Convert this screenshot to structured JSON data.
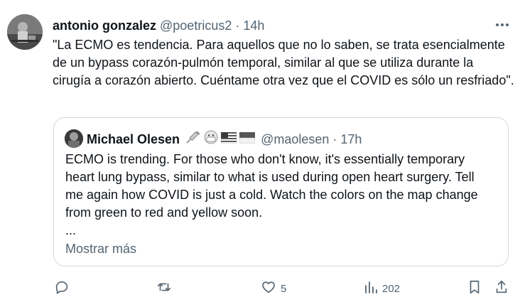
{
  "post": {
    "author_name": "antonio gonzalez",
    "author_handle": "@poetricus2",
    "separator": "·",
    "time": "14h",
    "text": "\"La ECMO es tendencia. Para aquellos que no lo saben, se trata esencialmente de un bypass corazón-pulmón temporal, similar al que se utiliza durante la cirugía a corazón abierto. Cuéntame otra vez que el COVID es sólo un resfriado\"."
  },
  "quoted": {
    "author_name": "Michael Olesen",
    "author_handle": "@maolesen",
    "separator": "·",
    "time": "17h",
    "emoji_icons": [
      "syringe-icon",
      "mask-face-icon",
      "us-flag-icon",
      "indonesia-flag-icon"
    ],
    "text_lines": [
      "ECMO is trending. For those who don't know, it's essentially temporary",
      "heart lung bypass, similar to what is used during open heart surgery. Tell",
      "me again how COVID is just a cold. Watch the colors on the map change",
      "from green to red and yellow soon.",
      "..."
    ],
    "show_more_label": "Mostrar más"
  },
  "actions": {
    "reply_icon": "reply-icon",
    "repost_icon": "repost-icon",
    "like_icon": "heart-icon",
    "like_count": "5",
    "views_icon": "views-icon",
    "views_count": "202",
    "bookmark_icon": "bookmark-icon",
    "share_icon": "share-icon"
  },
  "colors": {
    "text": "#0f1419",
    "muted": "#536471",
    "border": "#cfd9de",
    "background": "#ffffff"
  }
}
